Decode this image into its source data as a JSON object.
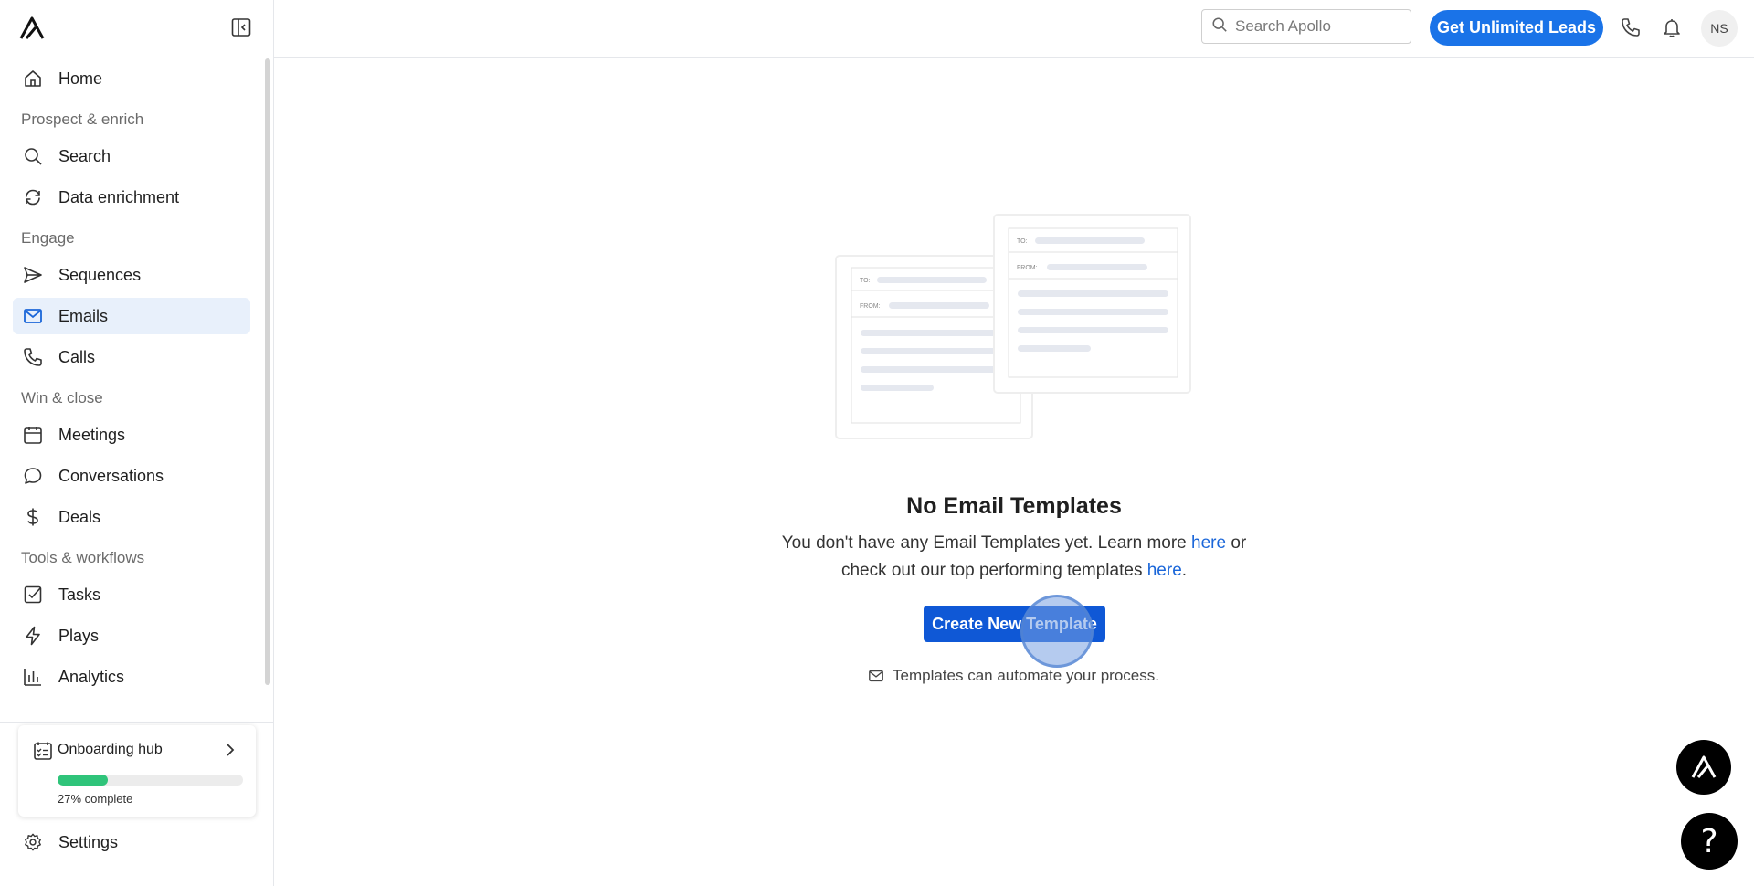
{
  "sidebar": {
    "brand_icon": "apollo-logo-icon",
    "collapse_icon": "sidebar-collapse-icon",
    "items": [
      {
        "type": "item",
        "label": "Home",
        "icon": "home-icon"
      },
      {
        "type": "section",
        "label": "Prospect & enrich"
      },
      {
        "type": "item",
        "label": "Search",
        "icon": "search-icon"
      },
      {
        "type": "item",
        "label": "Data enrichment",
        "icon": "refresh-icon"
      },
      {
        "type": "section",
        "label": "Engage"
      },
      {
        "type": "item",
        "label": "Sequences",
        "icon": "send-icon"
      },
      {
        "type": "item",
        "label": "Emails",
        "icon": "mail-icon",
        "active": true
      },
      {
        "type": "item",
        "label": "Calls",
        "icon": "phone-icon"
      },
      {
        "type": "section",
        "label": "Win & close"
      },
      {
        "type": "item",
        "label": "Meetings",
        "icon": "calendar-icon"
      },
      {
        "type": "item",
        "label": "Conversations",
        "icon": "chat-icon"
      },
      {
        "type": "item",
        "label": "Deals",
        "icon": "dollar-icon"
      },
      {
        "type": "section",
        "label": "Tools & workflows"
      },
      {
        "type": "item",
        "label": "Tasks",
        "icon": "checkbox-icon"
      },
      {
        "type": "item",
        "label": "Plays",
        "icon": "bolt-icon"
      },
      {
        "type": "item",
        "label": "Analytics",
        "icon": "bar-chart-icon"
      }
    ],
    "onboarding": {
      "title": "Onboarding hub",
      "progress_label": "27% complete",
      "progress_fraction": 0.27
    },
    "settings_label": "Settings"
  },
  "topbar": {
    "search_placeholder": "Search Apollo",
    "cta_label": "Get Unlimited Leads",
    "avatar_initials": "NS"
  },
  "main": {
    "title": "No Email Templates",
    "desc_part1": "You don't have any Email Templates yet. Learn more ",
    "link1": "here",
    "desc_part2": " or check out our top performing templates ",
    "link2": "here",
    "desc_part3": ".",
    "button_label": "Create New Template",
    "hint": "Templates can automate your process.",
    "illustration": {
      "to_label": "TO:",
      "from_label": "FROM:"
    }
  },
  "colors": {
    "accent": "#1a73e8",
    "primary_button": "#0f58d6",
    "active_nav_bg": "#e8f0fb",
    "progress": "#2fc47a"
  }
}
